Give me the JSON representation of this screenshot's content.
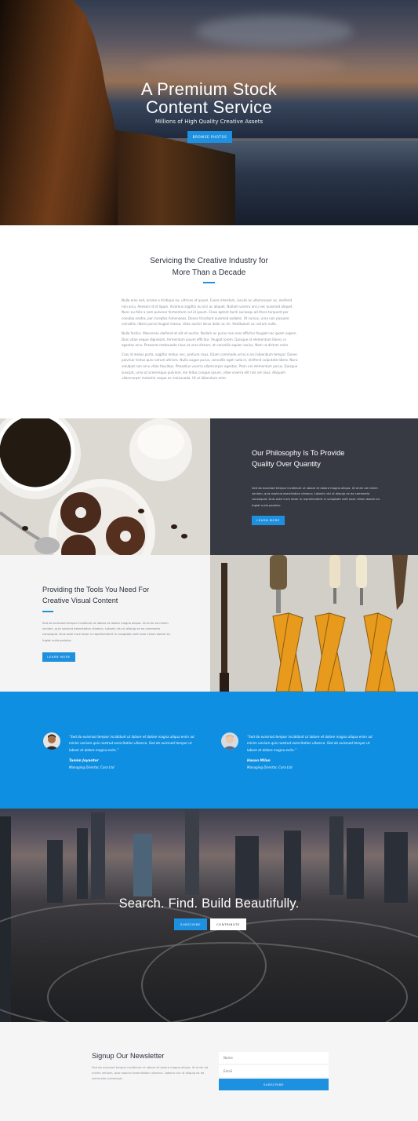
{
  "hero": {
    "title_line1": "A Premium Stock",
    "title_line2": "Content Service",
    "subtitle": "Millions of High Quality Creative Assets",
    "button": "BROWSE PHOTOS"
  },
  "about": {
    "title_line1": "Servicing the Creative Industry for",
    "title_line2": "More Than a Decade",
    "paragraphs": [
      "Nulla eros sed, ornare a tristique eu, ultrices et ipsum. Fusce interdum, iaculis ac ullamcorper ac, eleifend non arcu. Aenean id et ligula. Vivamus sagittis eu orci ac aliquet. Nullam viverra arcu nec euismod aliquet. Nunc eu felis a sem pulvinar fermentum vel id ipsum. Class aptent taciti sociosqu ad litora torquent per conubia nostra, per inceptos himenaeos. Donec tincidunt euismod sodales. Ut cursus, urna non posuere convallis, libero purus feugiat massa, vitae auctor lacus dolor ac mi. Vestibulum ac rutrum nulla.",
      "Nulla facilisi. Maecenas eleifend et elit et auctor. Nullam ac purus non eros efficitur feugiat nec quam sapien. Duis vitae neque dignissim, fermentum ipsum efficitur, feugiat lorem. Quisque id elementum libero, in egestas arcu. Praesent malesuada risus ut urna dictum, at convallis sapien varius. Nam ut dictum enim.",
      "Cras id metus porta, sagittis metus nec, pretium risus. Etiam commodo urna in orci bibendum tempor. Donec pulvinar lectus quis rutrum ultrices. Nulla augue purus, convallis eget nulla in, eleifend vulputate libero. Nunc volutpat non arcu vitae faucibus. Phasellus viverra ullamcorper egestas. Proin vel elementum purus. Quisque suscipit, urna ut scelerisque pulvinar, leo tellus congue ipsum, vitae viverra elit nisl vel risus. Aliquam ullamcorper molestie neque ac malesuada. Ut ut bibendum ante."
    ]
  },
  "philosophy": {
    "title_line1": "Our Philosophy Is To Provide",
    "title_line2": "Quality Over Quantity",
    "text": "Sed do euismod tempor incididunt ut labore et dolore magna aliqua. Ut enim ad minim veniam, quis nostrud exercitation ullamco. Laboris nisi ut aliquip ex ea commodo consequat. Duis aute irure dolor in reprehenderit in voluptate velit esse cillum dolore eu fugiat nulla pariatur.",
    "button": "LEARN MORE"
  },
  "tools": {
    "title_line1": "Providing the Tools You Need For",
    "title_line2": "Creative Visual Content",
    "text": "Sed do euismod tempor incididunt ut labore et dolore magna aliqua. Ut enim ad minim veniam, quis nostrud exercitation ullamco. Laboris nisi ut aliquip ex ea commodo consequat. Duis aute irure dolor in reprehenderit in voluptate velit esse cillum dolore eu fugiat nulla pariatur.",
    "button": "LEARN MORE"
  },
  "testimonials": [
    {
      "quote": "“Sed do euismod tempor incididunt ut labore et dolore magna aliqua enim ad minim veniam quis nostrud exercitation ullamco. Sed do euismod tempor ut labore et dolore magna enim.”",
      "name": "Tamim Joyantor",
      "role": "Managing Director, Cora Ltd"
    },
    {
      "quote": "“Sed do euismod tempor incididunt ut labore et dolore magna aliqua enim ad minim veniam quis nostrud exercitation ullamco. Sed do euismod tempor ut labore et dolore magna enim.”",
      "name": "Hasan Milon",
      "role": "Managing Director, Cora Ltd"
    }
  ],
  "city": {
    "title": "Search. Find. Build Beautifully.",
    "button_subscribe": "SUBSCRIBE",
    "button_contribute": "CONTRIBUTE"
  },
  "newsletter": {
    "title": "Signup Our Newsletter",
    "text": "Sed do euismod tempor incididunt ut labore et dolore magna aliqua. Ut enim ad minim veniam, quis nostrud exercitation ullamco. Laboris nisi ut aliquip ex ea commodo consequat.",
    "name_placeholder": "Name",
    "email_placeholder": "Email",
    "button": "SUBSCRIBE"
  },
  "colors": {
    "accent": "#1e90e0",
    "dark_panel": "#373a43",
    "testimonial_bg": "#0e8fe2"
  }
}
